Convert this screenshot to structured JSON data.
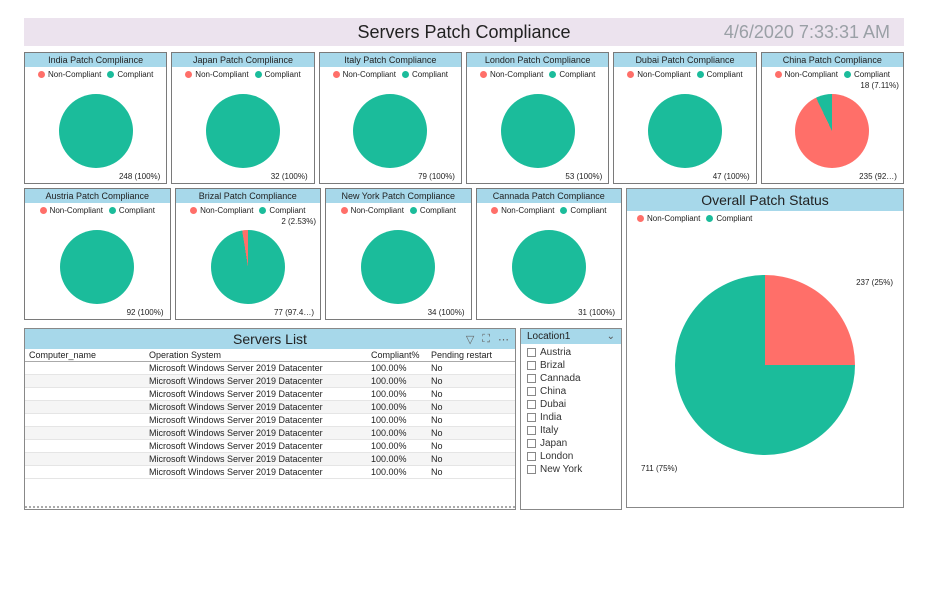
{
  "header": {
    "title": "Servers Patch Compliance",
    "timestamp": "4/6/2020 7:33:31 AM"
  },
  "legend": {
    "non_compliant": "Non-Compliant",
    "compliant": "Compliant"
  },
  "colors": {
    "non_compliant": "#ff6f69",
    "compliant": "#1bbc9b",
    "panel_header": "#a7d8ea"
  },
  "chart_data": [
    {
      "type": "pie",
      "title": "India Patch Compliance",
      "series": [
        {
          "name": "Compliant",
          "value": 248
        }
      ],
      "data_label": "248 (100%)"
    },
    {
      "type": "pie",
      "title": "Japan Patch Compliance",
      "series": [
        {
          "name": "Compliant",
          "value": 32
        }
      ],
      "data_label": "32 (100%)"
    },
    {
      "type": "pie",
      "title": "Italy Patch Compliance",
      "series": [
        {
          "name": "Compliant",
          "value": 79
        }
      ],
      "data_label": "79 (100%)"
    },
    {
      "type": "pie",
      "title": "London Patch Compliance",
      "series": [
        {
          "name": "Compliant",
          "value": 53
        }
      ],
      "data_label": "53 (100%)"
    },
    {
      "type": "pie",
      "title": "Dubai Patch Compliance",
      "series": [
        {
          "name": "Compliant",
          "value": 47
        }
      ],
      "data_label": "47 (100%)"
    },
    {
      "type": "pie",
      "title": "China Patch Compliance",
      "series": [
        {
          "name": "Non-Compliant",
          "value": 235
        },
        {
          "name": "Compliant",
          "value": 18
        }
      ],
      "data_label": "235 (92…)",
      "alt_label": "18 (7.11%)"
    },
    {
      "type": "pie",
      "title": "Austria Patch Compliance",
      "series": [
        {
          "name": "Compliant",
          "value": 92
        }
      ],
      "data_label": "92 (100%)"
    },
    {
      "type": "pie",
      "title": "Brizal Patch Compliance",
      "series": [
        {
          "name": "Compliant",
          "value": 77
        },
        {
          "name": "Non-Compliant",
          "value": 2
        }
      ],
      "data_label": "77 (97.4…)",
      "alt_label": "2 (2.53%)"
    },
    {
      "type": "pie",
      "title": "New York Patch Compliance",
      "series": [
        {
          "name": "Compliant",
          "value": 34
        }
      ],
      "data_label": "34 (100%)"
    },
    {
      "type": "pie",
      "title": "Cannada Patch Compliance",
      "series": [
        {
          "name": "Compliant",
          "value": 31
        }
      ],
      "data_label": "31 (100%)"
    }
  ],
  "overall": {
    "title": "Overall Patch Status",
    "type": "pie",
    "series": [
      {
        "name": "Non-Compliant",
        "value": 237,
        "pct": 25
      },
      {
        "name": "Compliant",
        "value": 711,
        "pct": 75
      }
    ],
    "label_nc": "237 (25%)",
    "label_c": "711 (75%)"
  },
  "servers": {
    "title": "Servers List",
    "columns": [
      "Computer_name",
      "Operation System",
      "Compliant%",
      "Pending restart"
    ],
    "rows": [
      {
        "os": "Microsoft Windows Server 2019 Datacenter",
        "pct": "100.00%",
        "restart": "No"
      },
      {
        "os": "Microsoft Windows Server 2019 Datacenter",
        "pct": "100.00%",
        "restart": "No"
      },
      {
        "os": "Microsoft Windows Server 2019 Datacenter",
        "pct": "100.00%",
        "restart": "No"
      },
      {
        "os": "Microsoft Windows Server 2019 Datacenter",
        "pct": "100.00%",
        "restart": "No"
      },
      {
        "os": "Microsoft Windows Server 2019 Datacenter",
        "pct": "100.00%",
        "restart": "No"
      },
      {
        "os": "Microsoft Windows Server 2019 Datacenter",
        "pct": "100.00%",
        "restart": "No"
      },
      {
        "os": "Microsoft Windows Server 2019 Datacenter",
        "pct": "100.00%",
        "restart": "No"
      },
      {
        "os": "Microsoft Windows Server 2019 Datacenter",
        "pct": "100.00%",
        "restart": "No"
      },
      {
        "os": "Microsoft Windows Server 2019 Datacenter",
        "pct": "100.00%",
        "restart": "No"
      }
    ]
  },
  "location": {
    "title": "Location1",
    "items": [
      "Austria",
      "Brizal",
      "Cannada",
      "China",
      "Dubai",
      "India",
      "Italy",
      "Japan",
      "London",
      "New York"
    ]
  }
}
